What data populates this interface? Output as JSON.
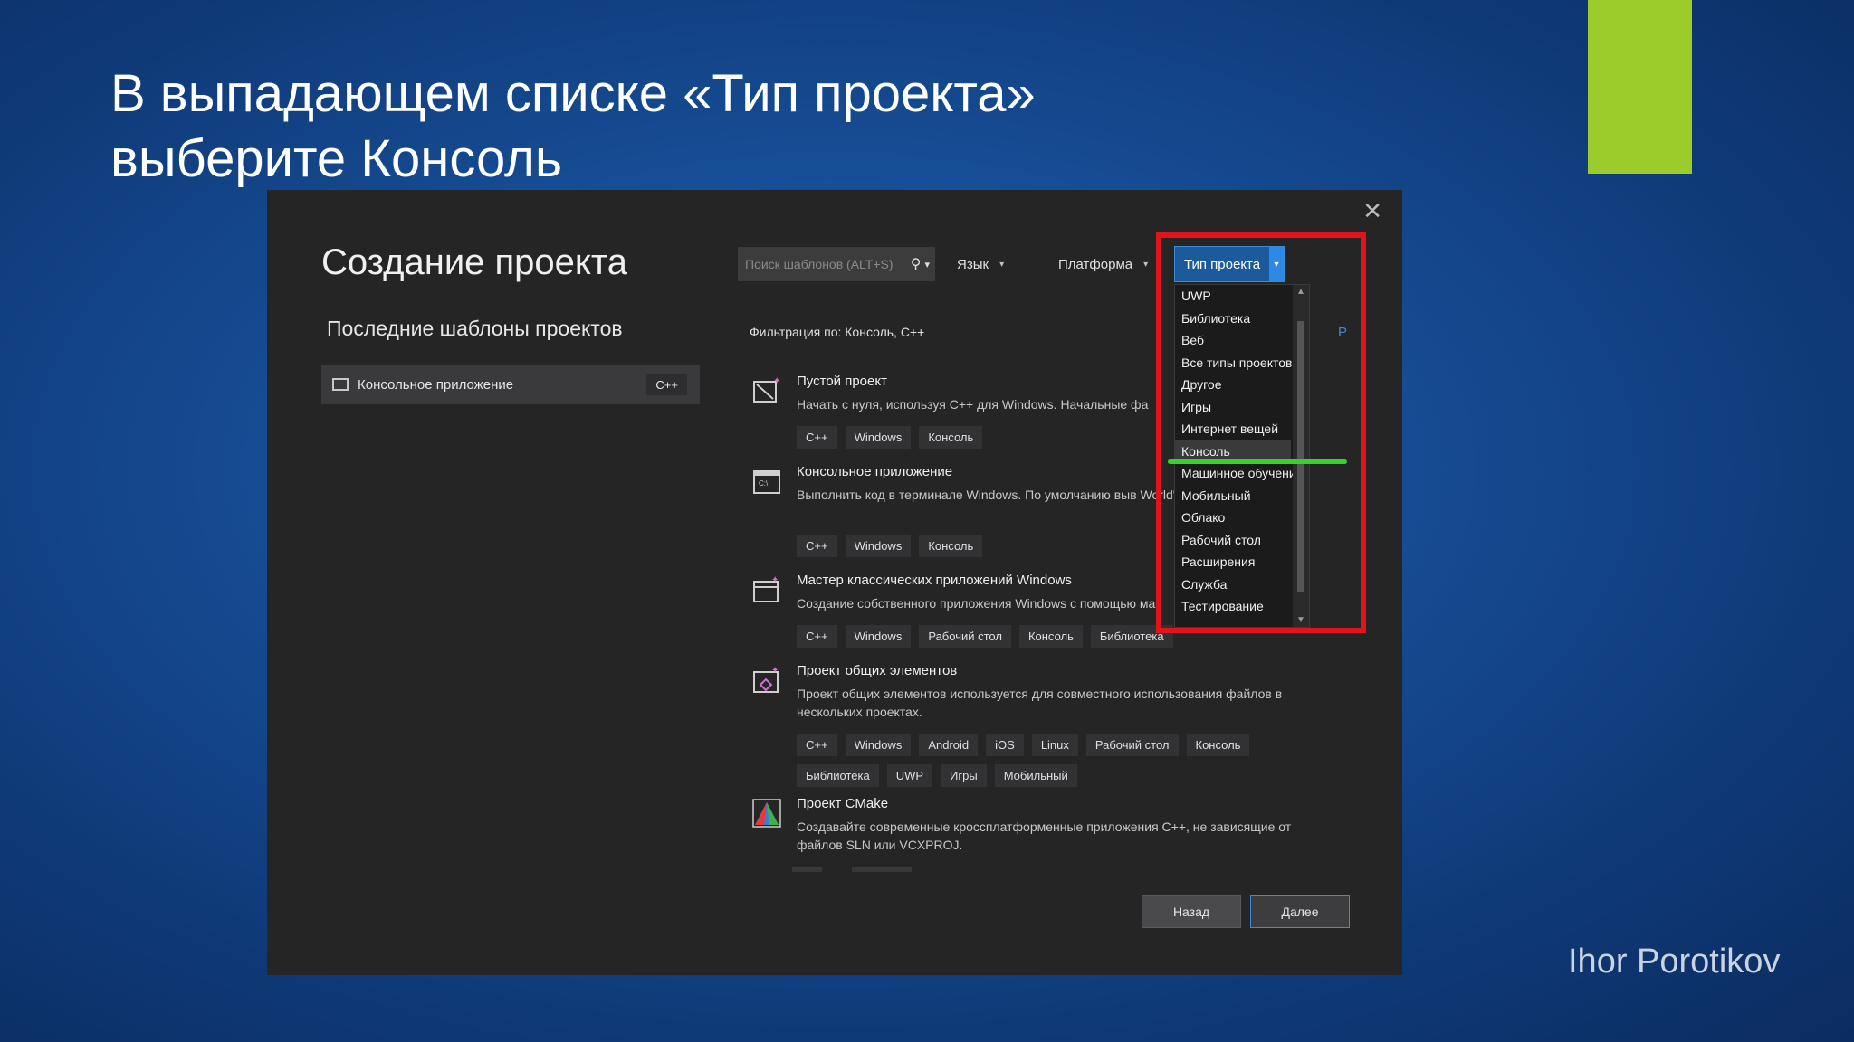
{
  "slide": {
    "title_line1": "В выпадающем списке «Тип проекта»",
    "title_line2": "выберите Консоль",
    "author": "Ihor Porotikov",
    "accent_color": "#9ccc2c",
    "highlight_color": "#e0141a",
    "underline_color": "#38d130"
  },
  "dialog": {
    "title": "Создание проекта",
    "close_icon": "close-icon",
    "recent_header": "Последние шаблоны проектов",
    "recent_items": [
      {
        "label": "Консольное приложение",
        "lang": "C++"
      }
    ],
    "search_placeholder": "Поиск шаблонов (ALT+S)",
    "filters": {
      "language": "Язык",
      "platform": "Платформа",
      "project_type": "Тип проекта"
    },
    "filter_line": "Фильтрация по: Консоль, C++",
    "partial_right": "P",
    "templates": [
      {
        "name": "Пустой проект",
        "desc": "Начать с нуля, используя C++ для Windows. Начальные фа",
        "tags": [
          "C++",
          "Windows",
          "Консоль"
        ]
      },
      {
        "name": "Консольное приложение",
        "desc": "Выполнить код в терминале Windows. По умолчанию выв World\".",
        "tags": [
          "C++",
          "Windows",
          "Консоль"
        ]
      },
      {
        "name": "Мастер классических приложений Windows",
        "desc": "Создание собственного приложения Windows с помощью ма",
        "tags": [
          "C++",
          "Windows",
          "Рабочий стол",
          "Консоль",
          "Библиотека"
        ]
      },
      {
        "name": "Проект общих элементов",
        "desc": "Проект общих элементов используется для совместного использования файлов в нескольких проектах.",
        "tags": [
          "C++",
          "Windows",
          "Android",
          "iOS",
          "Linux",
          "Рабочий стол",
          "Консоль",
          "Библиотека",
          "UWP",
          "Игры",
          "Мобильный"
        ]
      },
      {
        "name": "Проект CMake",
        "desc": "Создавайте современные кроссплатформенные приложения C++, не зависящие от файлов SLN или VCXPROJ.",
        "tags": []
      }
    ],
    "buttons": {
      "back": "Назад",
      "next": "Далее"
    },
    "project_type_options": [
      "UWP",
      "Библиотека",
      "Веб",
      "Все типы проектов",
      "Другое",
      "Игры",
      "Интернет вещей",
      "Консоль",
      "Машинное обучение",
      "Мобильный",
      "Облако",
      "Рабочий стол",
      "Расширения",
      "Служба",
      "Тестирование"
    ],
    "selected_option": "Консоль"
  }
}
